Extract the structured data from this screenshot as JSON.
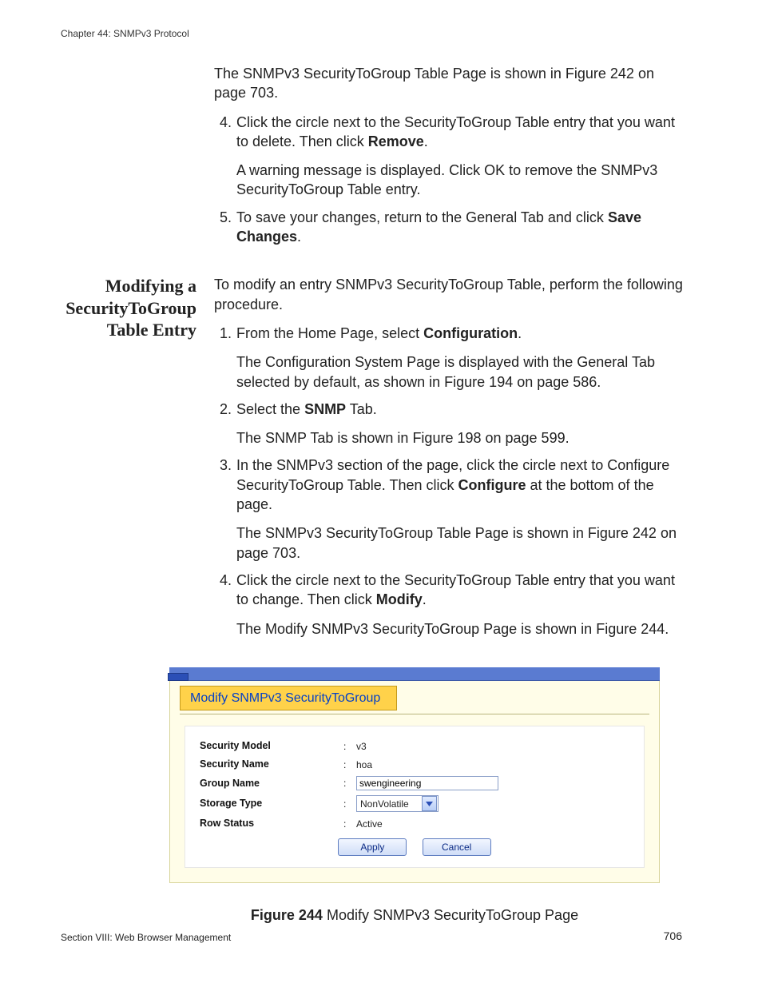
{
  "running_head": "Chapter 44: SNMPv3 Protocol",
  "intro_para": "The SNMPv3 SecurityToGroup Table Page is shown in Figure 242 on page 703.",
  "top_steps": {
    "s4_num": "4.",
    "s4_p1a": "Click the circle next to the SecurityToGroup Table entry that you want to delete. Then click ",
    "s4_p1b": "Remove",
    "s4_p1c": ".",
    "s4_p2": "A warning message is displayed. Click OK to remove the SNMPv3 SecurityToGroup Table entry.",
    "s5_num": "5.",
    "s5_p1a": "To save your changes, return to the General Tab and click ",
    "s5_p1b": "Save Changes",
    "s5_p1c": "."
  },
  "section_heading": "Modifying a SecurityToGroup Table Entry",
  "section_intro": "To modify an entry SNMPv3 SecurityToGroup Table, perform the following procedure.",
  "steps": {
    "s1_num": "1.",
    "s1_p1a": "From the Home Page, select ",
    "s1_p1b": "Configuration",
    "s1_p1c": ".",
    "s1_p2": "The Configuration System Page is displayed with the General Tab selected by default, as shown in Figure 194 on page 586.",
    "s2_num": "2.",
    "s2_p1a": "Select the ",
    "s2_p1b": "SNMP",
    "s2_p1c": " Tab.",
    "s2_p2": "The SNMP Tab is shown in Figure 198 on page 599.",
    "s3_num": "3.",
    "s3_p1a": "In the SNMPv3 section of the page, click the circle next to Configure SecurityToGroup Table. Then click ",
    "s3_p1b": "Configure",
    "s3_p1c": " at the bottom of the page.",
    "s3_p2": "The SNMPv3 SecurityToGroup Table Page is shown in Figure 242 on page 703.",
    "s4_num": "4.",
    "s4_p1a": "Click the circle next to the SecurityToGroup Table entry that you want to change. Then click ",
    "s4_p1b": "Modify",
    "s4_p1c": ".",
    "s4_p2": "The Modify SNMPv3 SecurityToGroup Page is shown in Figure 244."
  },
  "figure": {
    "panel_title": "Modify SNMPv3 SecurityToGroup",
    "rows": {
      "security_model_label": "Security Model",
      "security_model_value": "v3",
      "security_name_label": "Security Name",
      "security_name_value": "hoa",
      "group_name_label": "Group Name",
      "group_name_value": "swengineering",
      "storage_type_label": "Storage Type",
      "storage_type_value": "NonVolatile",
      "row_status_label": "Row Status",
      "row_status_value": "Active"
    },
    "buttons": {
      "apply": "Apply",
      "cancel": "Cancel"
    },
    "caption_label": "Figure 244",
    "caption_text": "  Modify SNMPv3 SecurityToGroup Page"
  },
  "footer": {
    "left": "Section VIII: Web Browser Management",
    "right": "706"
  }
}
